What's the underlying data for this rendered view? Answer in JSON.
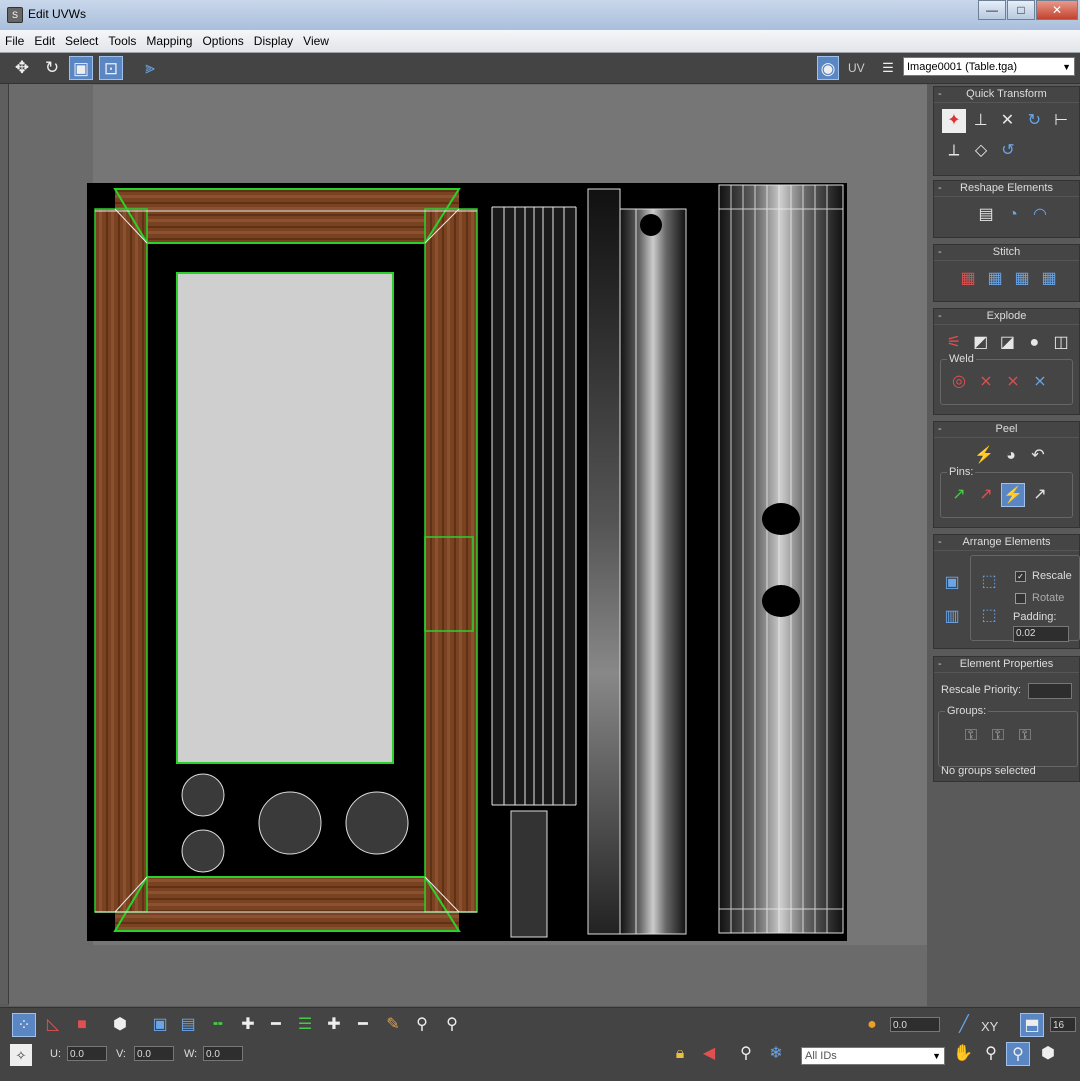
{
  "window": {
    "title": "Edit UVWs",
    "minimize": "—",
    "maximize": "□",
    "close": "✕"
  },
  "menu": [
    "File",
    "Edit",
    "Select",
    "Tools",
    "Mapping",
    "Options",
    "Display",
    "View"
  ],
  "toolbar": {
    "uv_label": "UV",
    "map_select": "Image0001 (Table.tga)"
  },
  "panel": {
    "quick_transform": "Quick Transform",
    "reshape_elements": "Reshape Elements",
    "stitch": "Stitch",
    "explode": "Explode",
    "weld": "Weld",
    "peel": "Peel",
    "pins": "Pins:",
    "arrange_elements": "Arrange Elements",
    "rescale": "Rescale",
    "rescale_checked": true,
    "rotate": "Rotate",
    "rotate_checked": false,
    "padding_label": "Padding:",
    "padding_value": "0.02",
    "element_properties": "Element Properties",
    "rescale_priority": "Rescale Priority:",
    "groups": "Groups:",
    "no_groups": "No groups selected",
    "collapse": "-"
  },
  "bottom": {
    "u_label": "U:",
    "u_value": "0.0",
    "v_label": "V:",
    "v_value": "0.0",
    "w_label": "W:",
    "w_value": "0.0",
    "soft_value": "0.0",
    "xy_label": "XY",
    "grid_value": "16",
    "id_select": "All IDs"
  },
  "colors": {
    "accent": "#5a86c4",
    "wood": "#7a4220",
    "seam": "#2bd12b",
    "checker_gray": "#cfcfcf"
  }
}
